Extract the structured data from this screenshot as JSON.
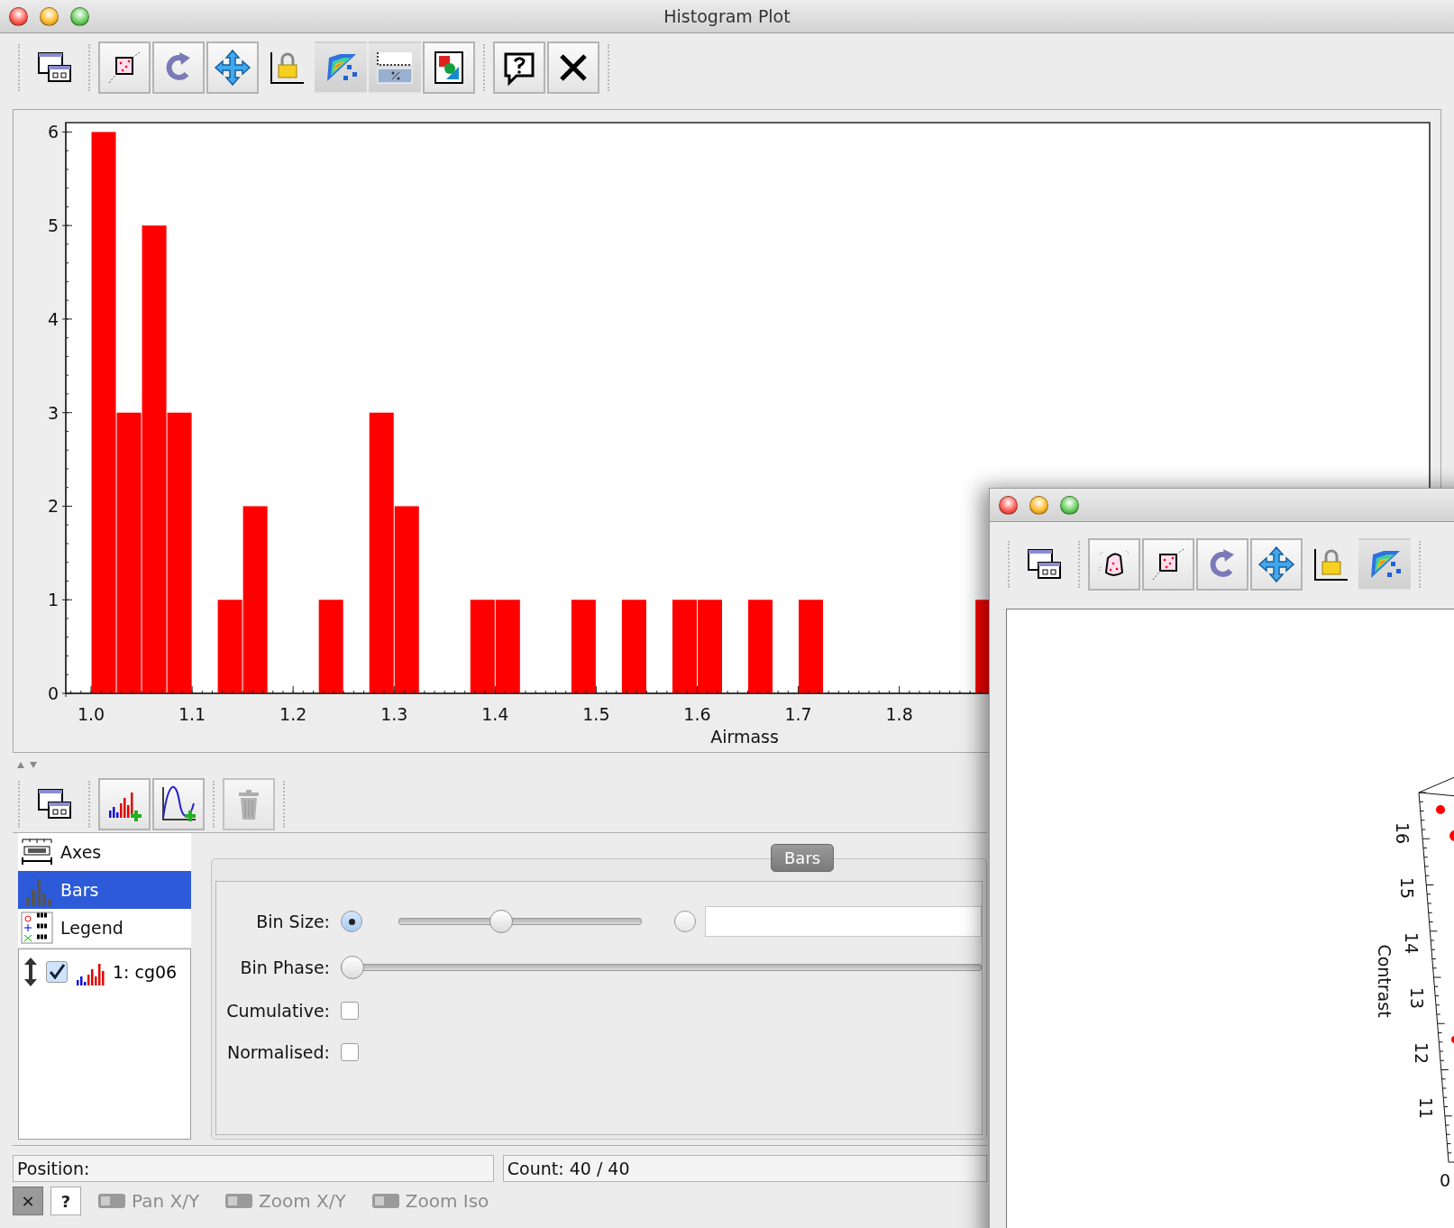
{
  "window": {
    "title": "Histogram Plot"
  },
  "toolbar": [
    [
      {
        "kind": "window",
        "selected": false
      }
    ],
    [
      {
        "kind": "zoom-region",
        "selected": false
      },
      {
        "kind": "rotate",
        "selected": false
      },
      {
        "kind": "pan",
        "selected": false
      },
      {
        "kind": "lock",
        "selected": false
      },
      {
        "kind": "density",
        "selected": true
      },
      {
        "kind": "percent",
        "selected": true
      },
      {
        "kind": "export",
        "selected": false
      }
    ],
    [
      {
        "kind": "help",
        "selected": false
      },
      {
        "kind": "close",
        "selected": false
      }
    ]
  ],
  "plot": {
    "chart_data": {
      "type": "bar",
      "xlabel": "Airmass",
      "x": [
        1.0125,
        1.0375,
        1.0625,
        1.0875,
        1.1375,
        1.1625,
        1.2375,
        1.2875,
        1.3125,
        1.3875,
        1.4125,
        1.4875,
        1.5375,
        1.5875,
        1.6125,
        1.6625,
        1.7125,
        1.8875
      ],
      "values": [
        6,
        3,
        5,
        3,
        1,
        2,
        1,
        3,
        2,
        1,
        1,
        1,
        1,
        1,
        1,
        1,
        1,
        1
      ],
      "xlim": [
        0.975,
        2.325
      ],
      "ylim": [
        0,
        6.1
      ],
      "xticks": [
        {
          "value": 1,
          "label": "1.0"
        },
        {
          "value": 1.1,
          "label": "1.1"
        },
        {
          "value": 1.2,
          "label": "1.2"
        },
        {
          "value": 1.3,
          "label": "1.3"
        },
        {
          "value": 1.4,
          "label": "1.4"
        },
        {
          "value": 1.5,
          "label": "1.5"
        },
        {
          "value": 1.6,
          "label": "1.6"
        },
        {
          "value": 1.7,
          "label": "1.7"
        },
        {
          "value": 1.8,
          "label": "1.8"
        }
      ],
      "yticks": [
        0,
        1,
        2,
        3,
        4,
        5,
        6
      ]
    }
  },
  "layer_toolbar": [
    [
      {
        "kind": "window",
        "disabled": false
      }
    ],
    [
      {
        "kind": "bars-add",
        "disabled": false
      },
      {
        "kind": "curve-add",
        "disabled": false
      }
    ],
    [
      {
        "kind": "trash",
        "disabled": true
      }
    ]
  ],
  "controls": [
    {
      "kind": "axes",
      "label": "Axes",
      "selected": false
    },
    {
      "kind": "bars",
      "label": "Bars",
      "selected": true
    },
    {
      "kind": "legend",
      "label": "Legend",
      "selected": false
    }
  ],
  "layers": [
    {
      "label": "1: cg06",
      "checked": true
    }
  ],
  "panel": {
    "tab": "Bars",
    "bin_size": {
      "label": "Bin Size:",
      "slider_selected": true,
      "level": 0.41,
      "field_selected": false
    },
    "bin_phase": {
      "label": "Bin Phase:",
      "level": 0
    },
    "checks": [
      {
        "label": "Cumulative:",
        "checked": false
      },
      {
        "label": "Normalised:",
        "checked": false
      }
    ]
  },
  "status": {
    "position": "Position:",
    "count": "Count: 40 / 40"
  },
  "bottom_buttons": [
    {
      "label": "✕",
      "selected": true
    },
    {
      "label": "?",
      "selected": false
    }
  ],
  "modes": [
    {
      "label": "Pan X/Y",
      "disabled": true
    },
    {
      "label": "Zoom X/Y",
      "disabled": true
    },
    {
      "label": "Zoom Iso",
      "disabled": true
    }
  ],
  "second_window": {
    "toolbar": [
      [
        {
          "kind": "window",
          "selected": false
        }
      ],
      [
        {
          "kind": "blob",
          "selected": false
        },
        {
          "kind": "zoom-region",
          "selected": false
        },
        {
          "kind": "rotate",
          "selected": false
        },
        {
          "kind": "pan",
          "selected": false
        },
        {
          "kind": "lock",
          "selected": false
        },
        {
          "kind": "density",
          "selected": true
        }
      ]
    ],
    "plot": {
      "axis_label": "Contrast",
      "tick_labels": [
        "16",
        "15",
        "14",
        "13",
        "12",
        "11"
      ],
      "corner_label": "0"
    }
  }
}
